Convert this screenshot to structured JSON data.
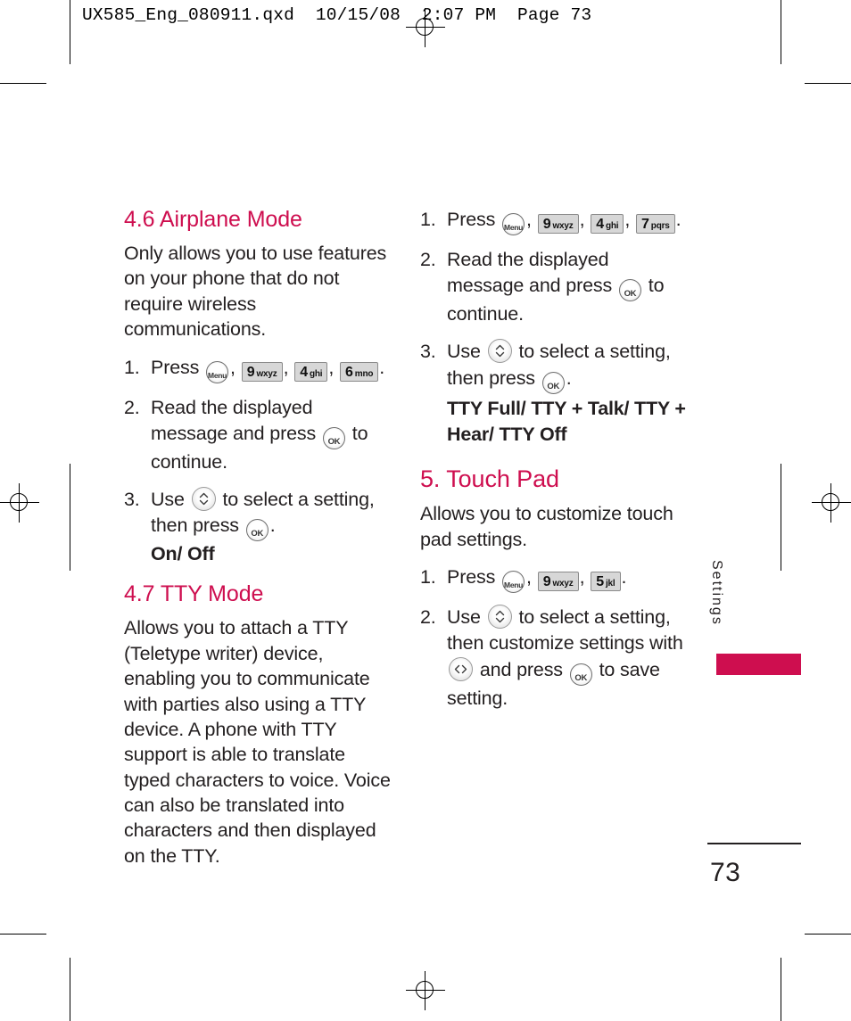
{
  "print_marks": {
    "slug_line": "UX585_Eng_080911.qxd  10/15/08  2:07 PM  Page 73"
  },
  "side_tab": {
    "label": "Settings",
    "accent_color": "#ce0e4f"
  },
  "folio": {
    "page_number": "73"
  },
  "left_column": {
    "section_46": {
      "heading": "4.6 Airplane Mode",
      "intro": "Only allows you to use features on your phone that do not require wireless communications.",
      "steps": [
        {
          "num": "1.",
          "text_before": "Press",
          "keys": [
            "menu",
            "9wxyz",
            "4ghi",
            "6mno"
          ],
          "text_after": "."
        },
        {
          "num": "2.",
          "text_before": "Read the displayed message and press",
          "keys": [
            "ok"
          ],
          "text_after": "to continue."
        },
        {
          "num": "3.",
          "text_before": "Use",
          "keys": [
            "updown"
          ],
          "text_mid": "to select a setting, then press",
          "keys2": [
            "ok"
          ],
          "text_after": ".",
          "options": "On/ Off"
        }
      ]
    },
    "section_47": {
      "heading": "4.7 TTY Mode",
      "intro": "Allows you to attach a TTY (Teletype writer) device, enabling you to communicate with parties also using a TTY device. A phone with TTY support is able to translate typed characters to voice. Voice can also be translated into characters and then displayed on the TTY."
    }
  },
  "right_column": {
    "section_47_steps": [
      {
        "num": "1.",
        "text_before": "Press",
        "keys": [
          "menu",
          "9wxyz",
          "4ghi",
          "7pqrs"
        ],
        "text_after": "."
      },
      {
        "num": "2.",
        "text_before": "Read the displayed message and press",
        "keys": [
          "ok"
        ],
        "text_after": "to continue."
      },
      {
        "num": "3.",
        "text_before": "Use",
        "keys": [
          "updown"
        ],
        "text_mid": "to select a setting, then press",
        "keys2": [
          "ok"
        ],
        "text_after": ".",
        "options": "TTY Full/ TTY + Talk/ TTY + Hear/ TTY Off"
      }
    ],
    "section_5": {
      "heading": "5. Touch Pad",
      "intro": "Allows you to customize touch pad settings.",
      "steps": [
        {
          "num": "1.",
          "text_before": "Press",
          "keys": [
            "menu",
            "9wxyz",
            "5jkl"
          ],
          "text_after": "."
        },
        {
          "num": "2.",
          "text_before": "Use",
          "keys": [
            "updown"
          ],
          "text_mid": "to select a setting, then customize settings with",
          "keys2": [
            "leftright"
          ],
          "text_mid2": "and press",
          "keys3": [
            "ok"
          ],
          "text_after": "to save setting."
        }
      ]
    }
  },
  "keys": {
    "menu": {
      "label": "Menu",
      "type": "round"
    },
    "ok": {
      "label": "OK",
      "type": "round"
    },
    "updown": {
      "label": "up-down-navigation",
      "type": "nav"
    },
    "leftright": {
      "label": "left-right-navigation",
      "type": "nav"
    },
    "9wxyz": {
      "digit": "9",
      "letters": "wxyz"
    },
    "4ghi": {
      "digit": "4",
      "letters": "ghi"
    },
    "6mno": {
      "digit": "6",
      "letters": "mno"
    },
    "7pqrs": {
      "digit": "7",
      "letters": "pqrs"
    },
    "5jkl": {
      "digit": "5",
      "letters": "jkl"
    }
  }
}
